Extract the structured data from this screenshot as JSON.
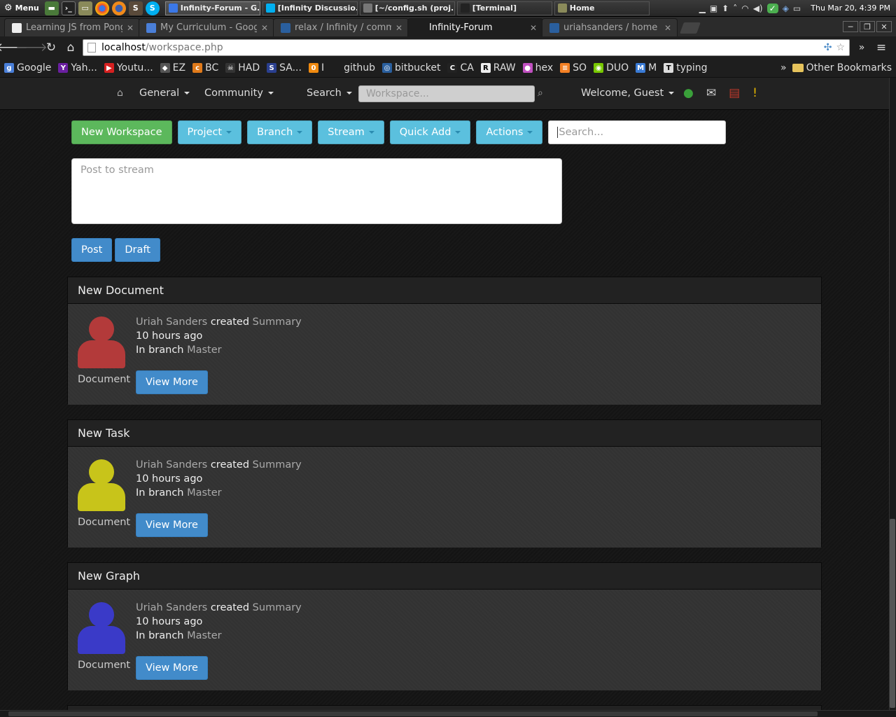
{
  "taskbar": {
    "menu_label": "Menu",
    "windows": [
      {
        "label": "Infinity-Forum - G...",
        "active": true
      },
      {
        "label": "[Infinity Discussio...",
        "active": false
      },
      {
        "label": "[~/config.sh (proj...",
        "active": false
      },
      {
        "label": "[Terminal]",
        "active": false
      },
      {
        "label": "Home",
        "active": false
      }
    ],
    "clock": "Thu Mar 20,  4:39 PM"
  },
  "browser": {
    "tabs": [
      {
        "title": "Learning JS from Pong",
        "active": false
      },
      {
        "title": "My Curriculum - Google",
        "active": false
      },
      {
        "title": "relax / Infinity / commit",
        "active": false
      },
      {
        "title": "Infinity-Forum",
        "active": true
      },
      {
        "title": "uriahsanders / home —",
        "active": false
      }
    ],
    "url_host": "localhost",
    "url_path": "/workspace.php",
    "bookmarks": [
      {
        "label": "Google",
        "icon": "google-icon",
        "color": "#4a7fd8",
        "glyph": "g"
      },
      {
        "label": "Yah...",
        "icon": "yahoo-icon",
        "color": "#6a1fa0",
        "glyph": "Y"
      },
      {
        "label": "Youtu...",
        "icon": "youtube-icon",
        "color": "#d62020",
        "glyph": "▶"
      },
      {
        "label": "EZ",
        "icon": "shield-icon",
        "color": "#555",
        "glyph": "◆"
      },
      {
        "label": "BC",
        "icon": "bc-icon",
        "color": "#e07a1a",
        "glyph": "c"
      },
      {
        "label": "HAD",
        "icon": "skull-icon",
        "color": "#333",
        "glyph": "☠"
      },
      {
        "label": "SA...",
        "icon": "sans-icon",
        "color": "#2a3f8f",
        "glyph": "S"
      },
      {
        "label": "I",
        "icon": "orange-icon",
        "color": "#f08a10",
        "glyph": "0"
      },
      {
        "label": "github",
        "icon": "github-icon",
        "color": "#1e1e1e",
        "glyph": ""
      },
      {
        "label": "bitbucket",
        "icon": "bitbucket-icon",
        "color": "#2a5f9e",
        "glyph": "◎"
      },
      {
        "label": "CA",
        "icon": "ca-icon",
        "color": "#222",
        "glyph": "C"
      },
      {
        "label": "RAW",
        "icon": "rs-icon",
        "color": "#eee",
        "glyph": "R"
      },
      {
        "label": "hex",
        "icon": "color-wheel-icon",
        "color": "#c050c0",
        "glyph": "●"
      },
      {
        "label": "SO",
        "icon": "stackoverflow-icon",
        "color": "#f48024",
        "glyph": "≡"
      },
      {
        "label": "DUO",
        "icon": "duo-icon",
        "color": "#78c800",
        "glyph": "◉"
      },
      {
        "label": "M",
        "icon": "m-icon",
        "color": "#3a7bd5",
        "glyph": "M"
      },
      {
        "label": "typing",
        "icon": "typing-icon",
        "color": "#ddd",
        "glyph": "T"
      }
    ],
    "more_glyph": "»",
    "other_bookmarks": "Other Bookmarks"
  },
  "site_nav": {
    "general": "General",
    "community": "Community",
    "search": "Search",
    "workspace_placeholder": "Workspace...",
    "welcome": "Welcome, Guest",
    "alert_glyph": "!"
  },
  "toolbar": {
    "new_workspace": "New Workspace",
    "project": "Project",
    "branch": "Branch",
    "stream": "Stream",
    "quick_add": "Quick Add",
    "actions": "Actions",
    "search_placeholder": "Search..."
  },
  "composer": {
    "placeholder": "Post to stream",
    "post": "Post",
    "draft": "Draft"
  },
  "feed": [
    {
      "title": "New Document",
      "author": "Uriah Sanders",
      "verb": "created",
      "object": "Summary",
      "time": "10 hours ago",
      "branch_prefix": "In branch",
      "branch": "Master",
      "type": "Document",
      "button": "View More",
      "avatar_color": "#b33a3a"
    },
    {
      "title": "New Task",
      "author": "Uriah Sanders",
      "verb": "created",
      "object": "Summary",
      "time": "10 hours ago",
      "branch_prefix": "In branch",
      "branch": "Master",
      "type": "Document",
      "button": "View More",
      "avatar_color": "#c8c41a"
    },
    {
      "title": "New Graph",
      "author": "Uriah Sanders",
      "verb": "created",
      "object": "Summary",
      "time": "10 hours ago",
      "branch_prefix": "In branch",
      "branch": "Master",
      "type": "Document",
      "button": "View More",
      "avatar_color": "#3a3ac8"
    }
  ]
}
